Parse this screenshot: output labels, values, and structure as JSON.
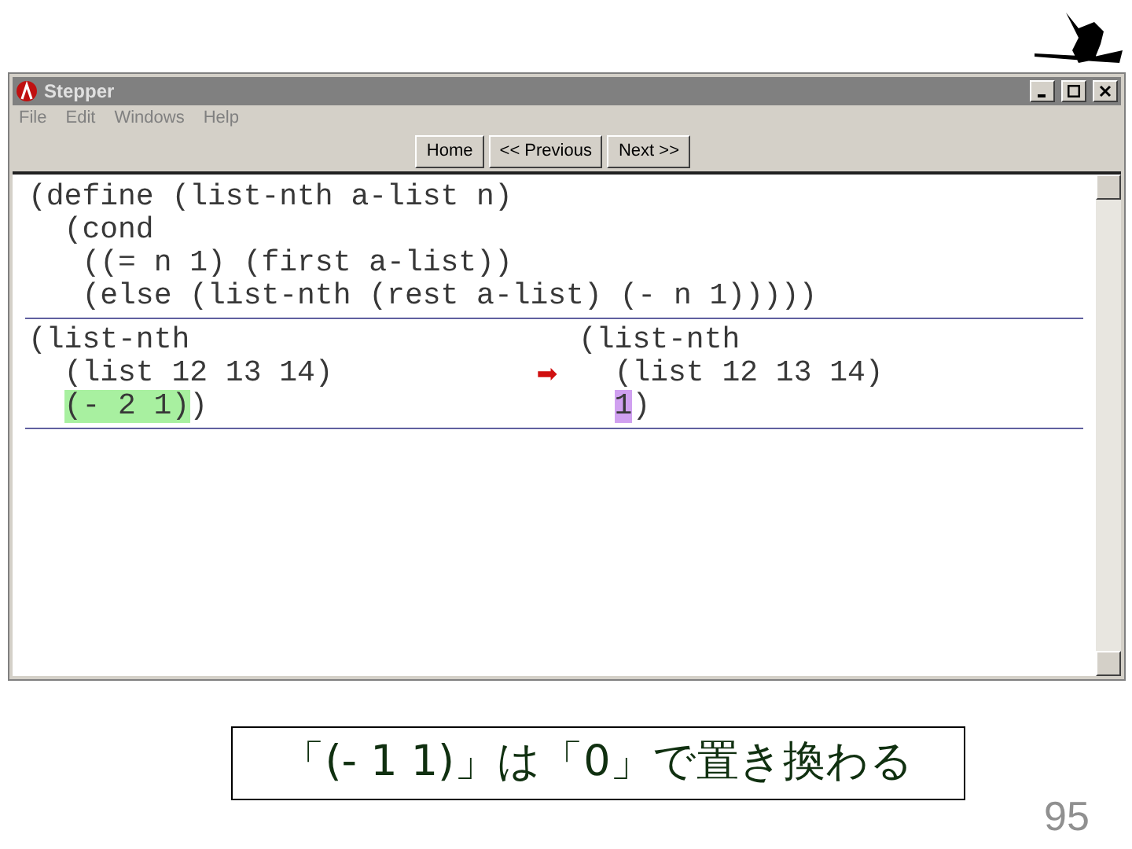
{
  "window": {
    "title": "Stepper"
  },
  "menu": [
    "File",
    "Edit",
    "Windows",
    "Help"
  ],
  "toolbar": [
    "Home",
    "<< Previous",
    "Next >>"
  ],
  "definition": [
    [
      {
        "text": "(define (list-nth a-list n)"
      }
    ],
    [
      {
        "text": "  (cond"
      }
    ],
    [
      {
        "text": "   ((= n 1) (first a-list))"
      }
    ],
    [
      {
        "text": "   (else (list-nth (rest a-list) (- n 1)))))"
      }
    ]
  ],
  "step": {
    "before": {
      "head": "(list-nth",
      "args": [
        [
          {
            "text": "(list 12 13 14)"
          }
        ],
        [
          {
            "text": "(- 2 1)",
            "color": "#a8f0a0"
          },
          {
            "text": ")"
          }
        ]
      ]
    },
    "arrow": "➡",
    "after": {
      "head": "(list-nth",
      "args": [
        [
          {
            "text": "(list 12 13 14)"
          }
        ],
        [
          {
            "text": "1",
            "color": "#d0a0f0"
          },
          {
            "text": ")"
          }
        ]
      ]
    }
  },
  "caption": "「(- 1 1)」は「0」で置き換わる",
  "page_number": "95"
}
